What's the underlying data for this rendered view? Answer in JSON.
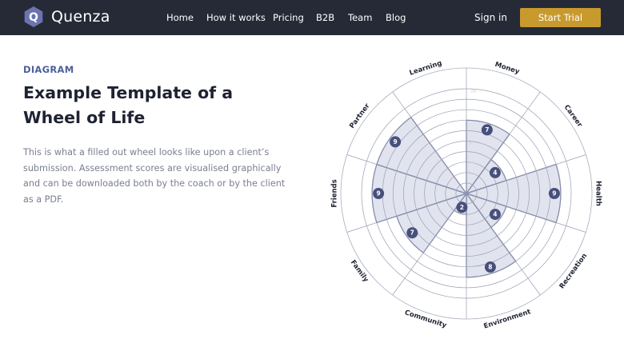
{
  "brand": {
    "name": "Quenza",
    "logo_letter": "Q"
  },
  "nav": {
    "items": [
      "Home",
      "How it works",
      "Pricing",
      "B2B",
      "Team",
      "Blog"
    ],
    "signin": "Sign in",
    "cta": "Start Trial"
  },
  "content": {
    "eyebrow": "DIAGRAM",
    "title": "Example Template of a Wheel of Life",
    "description": "This is what a filled out wheel looks like upon a client’s submission. Assessment scores are visualised graphically and can be downloaded both by the coach or by the client as a PDF."
  },
  "colors": {
    "nav_bg": "#252a36",
    "accent": "#c89a2e",
    "wheel_fill": "#e1e3ee",
    "wheel_stroke": "#5c6593",
    "badge": "#474f7c"
  },
  "wheel": {
    "max_score": 10,
    "segments": [
      {
        "label": "Money",
        "score": 7
      },
      {
        "label": "Career",
        "score": 4
      },
      {
        "label": "Health",
        "score": 9
      },
      {
        "label": "Recreation",
        "score": 4
      },
      {
        "label": "Environment",
        "score": 8
      },
      {
        "label": "Community",
        "score": 2
      },
      {
        "label": "Family",
        "score": 7
      },
      {
        "label": "Friends",
        "score": 9
      },
      {
        "label": "Partner",
        "score": 9
      },
      {
        "label": "Learning",
        "score": 0
      }
    ],
    "scale_ticks": [
      "10",
      "5"
    ]
  }
}
